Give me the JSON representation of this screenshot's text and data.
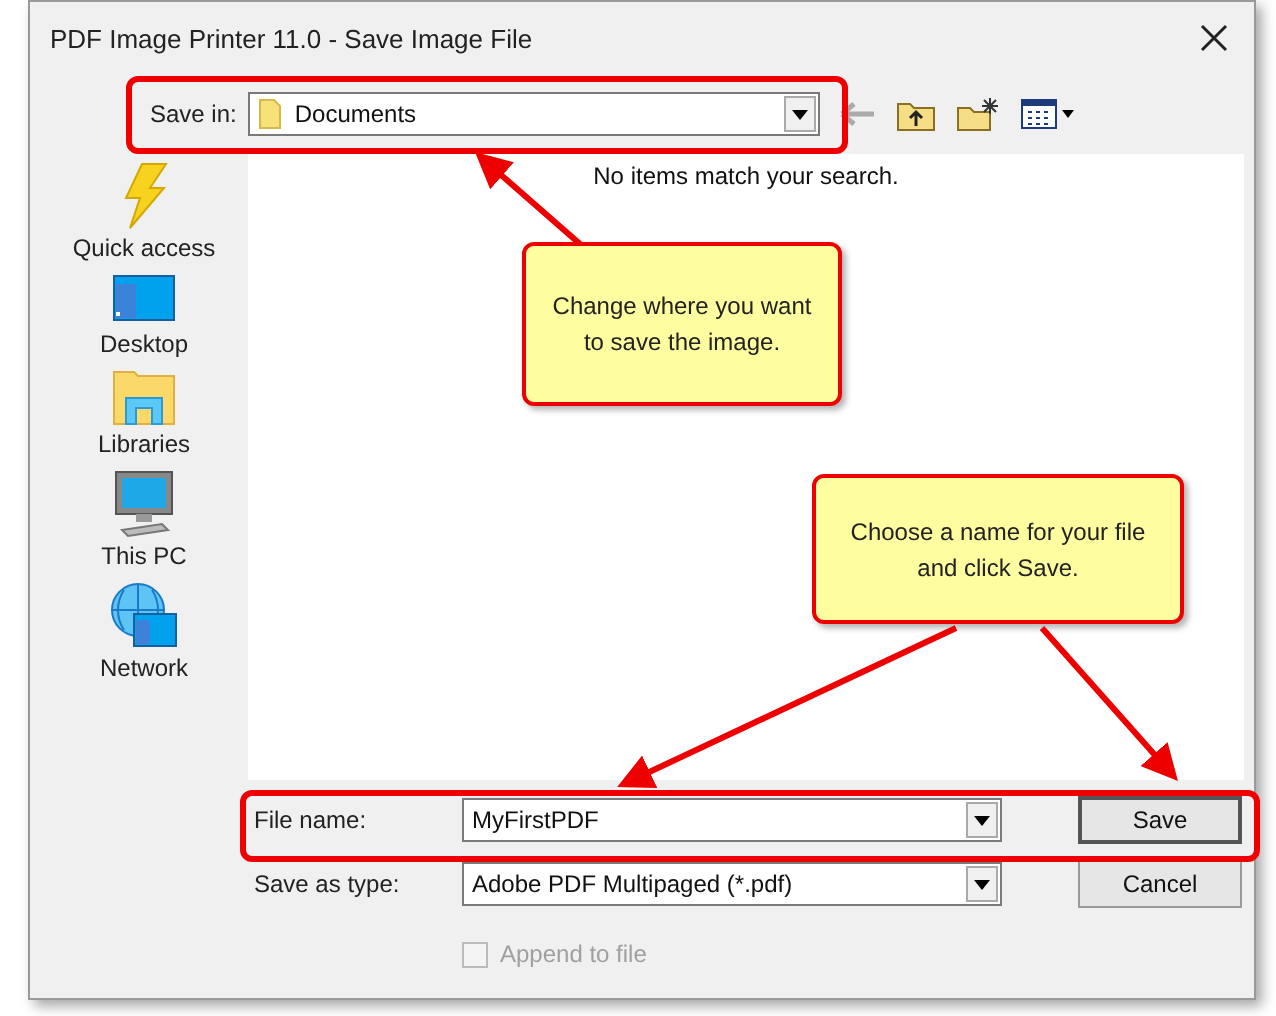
{
  "window": {
    "title": "PDF Image Printer 11.0 - Save Image File"
  },
  "save_in": {
    "label": "Save in:",
    "value": "Documents"
  },
  "places": [
    {
      "label": "Quick access",
      "kind": "quick"
    },
    {
      "label": "Desktop",
      "kind": "desktop"
    },
    {
      "label": "Libraries",
      "kind": "libraries"
    },
    {
      "label": "This PC",
      "kind": "pc"
    },
    {
      "label": "Network",
      "kind": "network"
    }
  ],
  "file_list": {
    "empty_message": "No items match your search."
  },
  "file_name": {
    "label": "File name:",
    "value": "MyFirstPDF"
  },
  "save_as_type": {
    "label": "Save as type:",
    "value": "Adobe PDF Multipaged (*.pdf)"
  },
  "append_checkbox": {
    "label": "Append to file",
    "checked": false,
    "disabled": true
  },
  "buttons": [
    {
      "label": "Save",
      "default": true
    },
    {
      "label": "Cancel",
      "default": false
    }
  ],
  "callouts": [
    {
      "text": "Change where you want to save the image."
    },
    {
      "text": "Choose a name for your file and click Save."
    }
  ]
}
